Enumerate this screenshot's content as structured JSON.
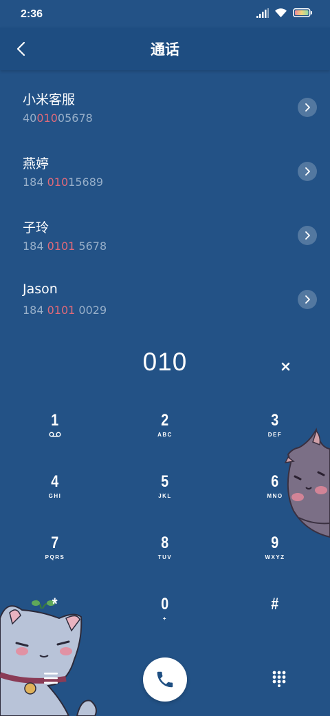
{
  "status": {
    "time": "2:36"
  },
  "header": {
    "title": "通话"
  },
  "contacts": [
    {
      "name": "小米客服",
      "num_pre": "40",
      "num_hl": "010",
      "num_post": "05678"
    },
    {
      "name": "燕婷",
      "num_pre": "184 ",
      "num_hl": "010",
      "num_post": "15689"
    },
    {
      "name": "子玲",
      "num_pre": "184 ",
      "num_hl": "0101",
      "num_post": " 5678"
    },
    {
      "name": "Jason",
      "num_pre": "184 ",
      "num_hl": "0101",
      "num_post": " 0029"
    }
  ],
  "dialer": {
    "input": "010",
    "keys": [
      {
        "digit": "1",
        "letters": ""
      },
      {
        "digit": "2",
        "letters": "ABC"
      },
      {
        "digit": "3",
        "letters": "DEF"
      },
      {
        "digit": "4",
        "letters": "GHI"
      },
      {
        "digit": "5",
        "letters": "JKL"
      },
      {
        "digit": "6",
        "letters": "MNO"
      },
      {
        "digit": "7",
        "letters": "PQRS"
      },
      {
        "digit": "8",
        "letters": "TUV"
      },
      {
        "digit": "9",
        "letters": "WXYZ"
      },
      {
        "digit": "*",
        "letters": ""
      },
      {
        "digit": "0",
        "letters": "+"
      },
      {
        "digit": "#",
        "letters": ""
      }
    ]
  },
  "colors": {
    "background": "#235286",
    "header": "#1e4d81",
    "highlight": "#e06a79",
    "number_text": "#97afc9"
  },
  "icons": {
    "back": "chevron-left-icon",
    "clear": "close-icon",
    "voicemail": "voicemail-icon",
    "menu": "menu-icon",
    "call": "phone-icon",
    "keypad": "dialpad-icon",
    "arrow": "chevron-right-icon"
  }
}
